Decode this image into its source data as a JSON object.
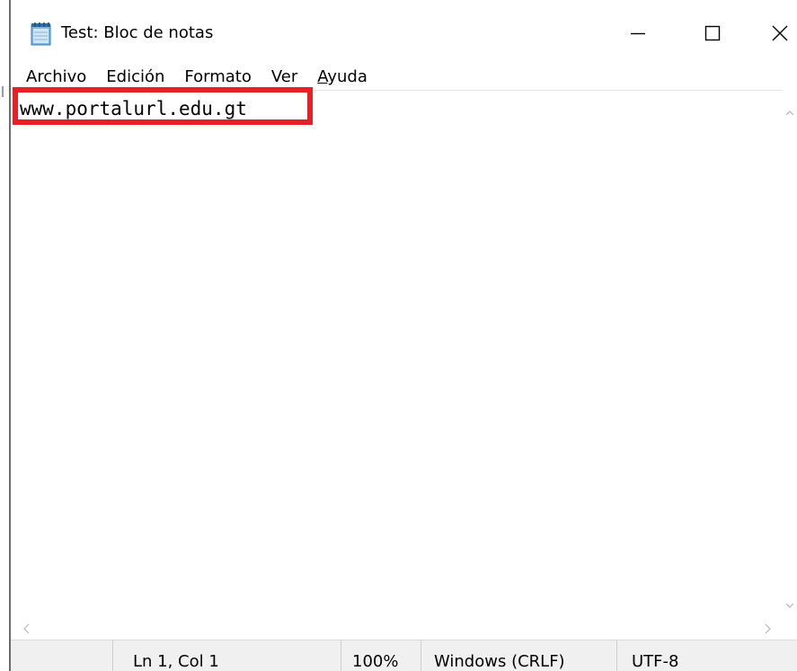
{
  "window": {
    "title": "Test: Bloc de notas",
    "icon": "notepad-icon"
  },
  "title_buttons": {
    "minimize_icon": "minimize-icon",
    "maximize_icon": "maximize-icon",
    "close_icon": "close-icon"
  },
  "menu": {
    "items": [
      {
        "label": "Archivo"
      },
      {
        "label": "Edición"
      },
      {
        "label": "Formato"
      },
      {
        "label": "Ver"
      },
      {
        "mnemonic": "A",
        "rest": "yuda"
      }
    ]
  },
  "editor": {
    "content": "www.portalurl.edu.gt"
  },
  "annotation": {
    "highlight_color": "#e52027"
  },
  "statusbar": {
    "position": "Ln 1, Col 1",
    "zoom": "100%",
    "line_ending": "Windows (CRLF)",
    "encoding": "UTF-8"
  }
}
